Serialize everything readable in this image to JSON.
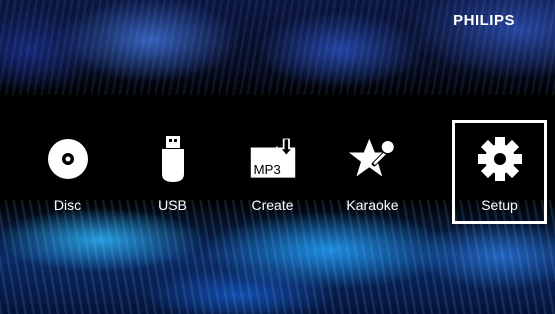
{
  "brand": {
    "name": "PHILIPS"
  },
  "menu": {
    "items": [
      {
        "label": "Disc",
        "icon": "disc-icon",
        "selected": false
      },
      {
        "label": "USB",
        "icon": "usb-icon",
        "selected": false
      },
      {
        "label": "Create",
        "icon": "mp3-create-icon",
        "icon_text": "MP3",
        "selected": false
      },
      {
        "label": "Karaoke",
        "icon": "karaoke-star-icon",
        "selected": false
      },
      {
        "label": "Setup",
        "icon": "gear-icon",
        "selected": true
      }
    ]
  },
  "colors": {
    "text": "#ffffff",
    "selection_border": "#ffffff",
    "background_band": "#000000",
    "accent_blue": "#1e96eb"
  }
}
